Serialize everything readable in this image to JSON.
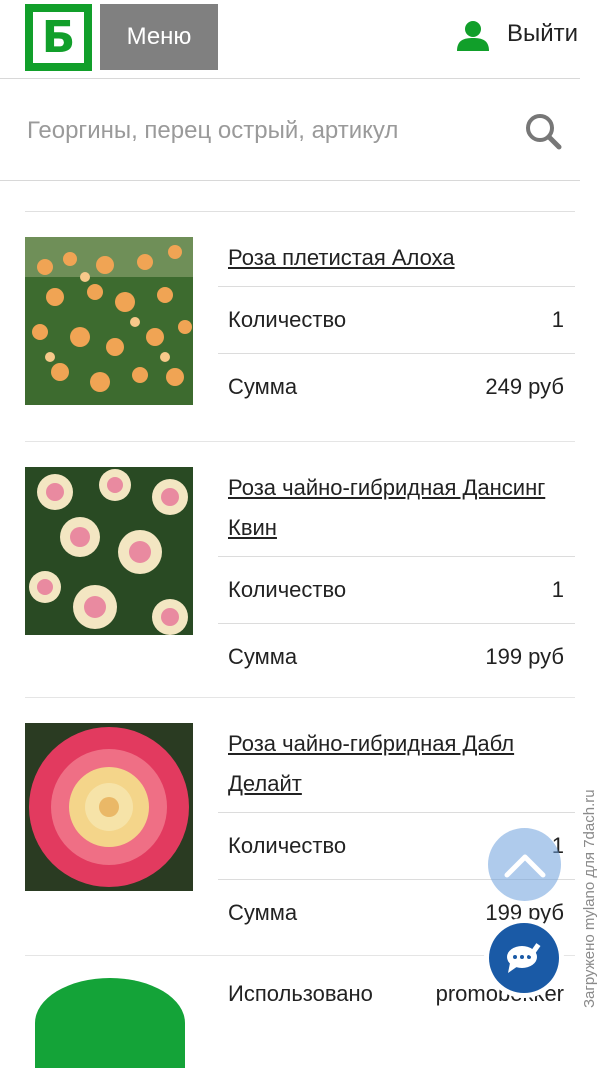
{
  "header": {
    "logo_letter": "Б",
    "menu_label": "Меню",
    "logout_label": "Выйти"
  },
  "search": {
    "placeholder": "Георгины, перец острый, артикул"
  },
  "items": [
    {
      "title_line1": "Роза плетистая Алоха",
      "title_line2": "",
      "qty_label": "Количество",
      "qty": "1",
      "sum_label": "Сумма",
      "sum": "249 руб"
    },
    {
      "title_line1": "Роза чайно-гибридная Дансинг",
      "title_line2": "Квин",
      "qty_label": "Количество",
      "qty": "1",
      "sum_label": "Сумма",
      "sum": "199 руб"
    },
    {
      "title_line1": "Роза чайно-гибридная Дабл",
      "title_line2": "Делайт",
      "qty_label": "Количество",
      "qty": "1",
      "sum_label": "Сумма",
      "sum": "199 руб"
    }
  ],
  "promo": {
    "label": "Использовано",
    "value": "promobekker"
  },
  "watermark": "Загружено mylano для 7dach.ru",
  "colors": {
    "brand_green": "#119f2a",
    "menu_gray": "#808080",
    "chat_blue": "#1a5aa6"
  },
  "icons": [
    "user-icon",
    "search-icon",
    "chevron-up-icon",
    "chat-icon"
  ]
}
